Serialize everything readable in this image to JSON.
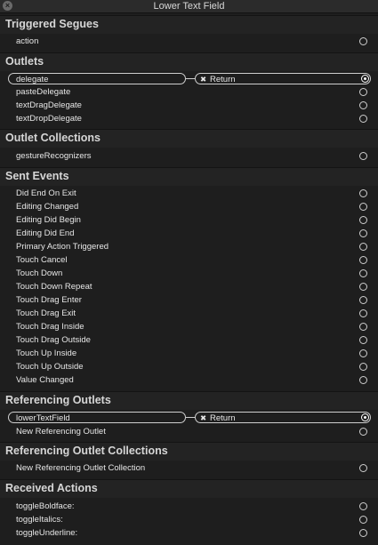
{
  "window": {
    "title": "Lower Text Field"
  },
  "sections": {
    "triggered_segues": {
      "title": "Triggered Segues",
      "items": [
        "action"
      ]
    },
    "outlets": {
      "title": "Outlets",
      "items": [
        "delegate",
        "pasteDelegate",
        "textDragDelegate",
        "textDropDelegate"
      ],
      "connected": {
        "source": "delegate",
        "target": "Return"
      }
    },
    "outlet_collections": {
      "title": "Outlet Collections",
      "items": [
        "gestureRecognizers"
      ]
    },
    "sent_events": {
      "title": "Sent Events",
      "items": [
        "Did End On Exit",
        "Editing Changed",
        "Editing Did Begin",
        "Editing Did End",
        "Primary Action Triggered",
        "Touch Cancel",
        "Touch Down",
        "Touch Down Repeat",
        "Touch Drag Enter",
        "Touch Drag Exit",
        "Touch Drag Inside",
        "Touch Drag Outside",
        "Touch Up Inside",
        "Touch Up Outside",
        "Value Changed"
      ]
    },
    "referencing_outlets": {
      "title": "Referencing Outlets",
      "items": [
        "lowerTextField",
        "New Referencing Outlet"
      ],
      "connected": {
        "source": "lowerTextField",
        "target": "Return"
      }
    },
    "referencing_outlet_collections": {
      "title": "Referencing Outlet Collections",
      "items": [
        "New Referencing Outlet Collection"
      ]
    },
    "received_actions": {
      "title": "Received Actions",
      "items": [
        "toggleBoldface:",
        "toggleItalics:",
        "toggleUnderline:"
      ]
    }
  },
  "icons": {
    "close": "close-icon",
    "remove_connection": "x-icon",
    "connection_circle": "circle-icon"
  }
}
